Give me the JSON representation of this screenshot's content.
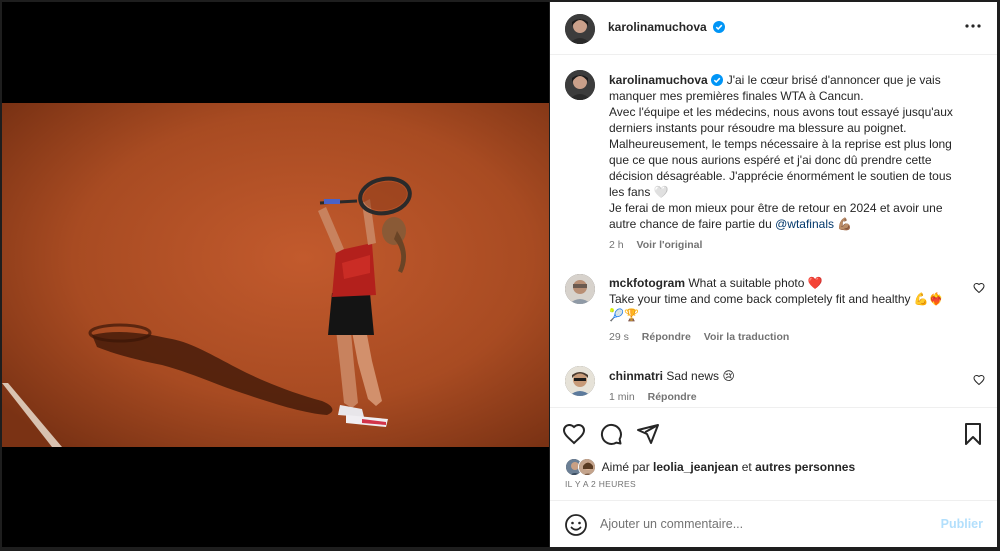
{
  "post": {
    "author": "karolinamuchova",
    "more_icon": "more-horizontal-icon",
    "verified_icon": "verified-badge-icon"
  },
  "caption": {
    "author": "karolinamuchova",
    "lines": [
      "J'ai le cœur brisé d'annoncer que je vais",
      "manquer mes premières finales WTA à Cancun.",
      "Avec l'équipe et les médecins, nous avons tout essayé jusqu'aux",
      "derniers instants pour résoudre ma blessure au poignet.",
      "Malheureusement, le temps nécessaire à la reprise est plus long",
      "que ce que nous aurions espéré et j'ai donc dû prendre cette",
      "décision désagréable. J'apprécie énormément le soutien de tous",
      "les fans 🤍",
      "Je ferai de mon mieux pour être de retour en 2024 et avoir une"
    ],
    "last_line_prefix": "autre chance de faire partie du ",
    "mention": "@wtafinals",
    "last_line_suffix": " 💪🏽",
    "time": "2 h",
    "see_original": "Voir l'original"
  },
  "comments": [
    {
      "user": "mckfotogram",
      "text_inline": "What a suitable photo ❤️",
      "text_line2": "Take your time and come back completely fit and healthy 💪❤️‍🔥",
      "text_line3": "🎾🏆",
      "time": "29 s",
      "reply": "Répondre",
      "translate": "Voir la traduction"
    },
    {
      "user": "chinmatri",
      "text_inline": "Sad news 😢",
      "time": "1 min",
      "reply": "Répondre"
    }
  ],
  "likes": {
    "prefix": "Aimé par ",
    "user": "leolia_jeanjean",
    "middle": " et ",
    "others": "autres personnes"
  },
  "posted_ago": "IL Y A 2 HEURES",
  "add_comment": {
    "placeholder": "Ajouter un commentaire...",
    "publish": "Publier"
  },
  "colors": {
    "accent_link": "#00376b",
    "verified": "#0095f6",
    "publish_disabled": "#b2dffc",
    "clay": "#b5552a"
  }
}
